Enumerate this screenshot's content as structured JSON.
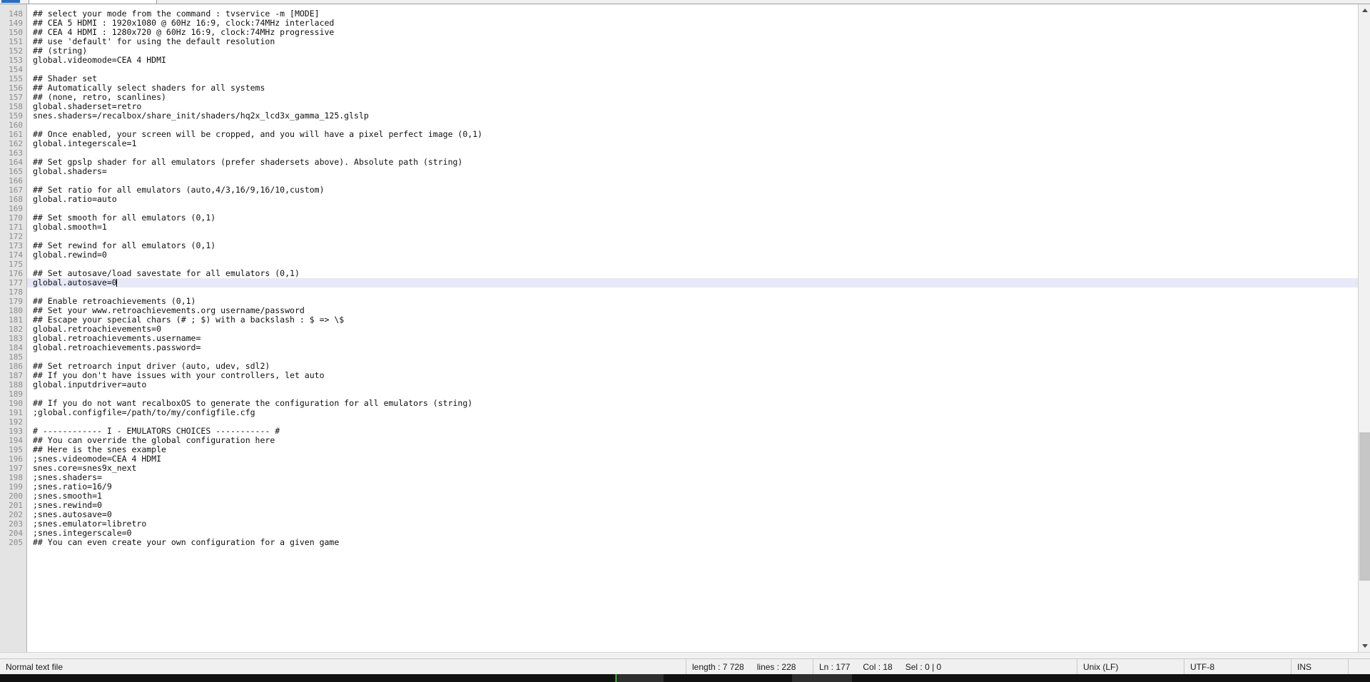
{
  "window": {
    "app": "text-editor",
    "colors": {
      "gutter_bg": "#e4e4e4",
      "gutter_fg": "#8c8c8c",
      "text_fg": "#101010",
      "current_line_bg": "#e8e8f8",
      "chrome_bg": "#f0f0f0"
    }
  },
  "editor": {
    "first_line": 148,
    "current_line": 177,
    "lines": [
      {
        "n": 148,
        "text": "## select your mode from the command : tvservice -m [MODE]"
      },
      {
        "n": 149,
        "text": "## CEA 5 HDMI : 1920x1080 @ 60Hz 16:9, clock:74MHz interlaced"
      },
      {
        "n": 150,
        "text": "## CEA 4 HDMI : 1280x720 @ 60Hz 16:9, clock:74MHz progressive"
      },
      {
        "n": 151,
        "text": "## use 'default' for using the default resolution"
      },
      {
        "n": 152,
        "text": "## (string)"
      },
      {
        "n": 153,
        "text": "global.videomode=CEA 4 HDMI"
      },
      {
        "n": 154,
        "text": ""
      },
      {
        "n": 155,
        "text": "## Shader set"
      },
      {
        "n": 156,
        "text": "## Automatically select shaders for all systems"
      },
      {
        "n": 157,
        "text": "## (none, retro, scanlines)"
      },
      {
        "n": 158,
        "text": "global.shaderset=retro"
      },
      {
        "n": 159,
        "text": "snes.shaders=/recalbox/share_init/shaders/hq2x_lcd3x_gamma_125.glslp"
      },
      {
        "n": 160,
        "text": ""
      },
      {
        "n": 161,
        "text": "## Once enabled, your screen will be cropped, and you will have a pixel perfect image (0,1)"
      },
      {
        "n": 162,
        "text": "global.integerscale=1"
      },
      {
        "n": 163,
        "text": ""
      },
      {
        "n": 164,
        "text": "## Set gpslp shader for all emulators (prefer shadersets above). Absolute path (string)"
      },
      {
        "n": 165,
        "text": "global.shaders="
      },
      {
        "n": 166,
        "text": ""
      },
      {
        "n": 167,
        "text": "## Set ratio for all emulators (auto,4/3,16/9,16/10,custom)"
      },
      {
        "n": 168,
        "text": "global.ratio=auto"
      },
      {
        "n": 169,
        "text": ""
      },
      {
        "n": 170,
        "text": "## Set smooth for all emulators (0,1)"
      },
      {
        "n": 171,
        "text": "global.smooth=1"
      },
      {
        "n": 172,
        "text": ""
      },
      {
        "n": 173,
        "text": "## Set rewind for all emulators (0,1)"
      },
      {
        "n": 174,
        "text": "global.rewind=0"
      },
      {
        "n": 175,
        "text": ""
      },
      {
        "n": 176,
        "text": "## Set autosave/load savestate for all emulators (0,1)"
      },
      {
        "n": 177,
        "text": "global.autosave=0"
      },
      {
        "n": 178,
        "text": ""
      },
      {
        "n": 179,
        "text": "## Enable retroachievements (0,1)"
      },
      {
        "n": 180,
        "text": "## Set your www.retroachievements.org username/password"
      },
      {
        "n": 181,
        "text": "## Escape your special chars (# ; $) with a backslash : $ => \\$"
      },
      {
        "n": 182,
        "text": "global.retroachievements=0"
      },
      {
        "n": 183,
        "text": "global.retroachievements.username="
      },
      {
        "n": 184,
        "text": "global.retroachievements.password="
      },
      {
        "n": 185,
        "text": ""
      },
      {
        "n": 186,
        "text": "## Set retroarch input driver (auto, udev, sdl2)"
      },
      {
        "n": 187,
        "text": "## If you don't have issues with your controllers, let auto"
      },
      {
        "n": 188,
        "text": "global.inputdriver=auto"
      },
      {
        "n": 189,
        "text": ""
      },
      {
        "n": 190,
        "text": "## If you do not want recalboxOS to generate the configuration for all emulators (string)"
      },
      {
        "n": 191,
        "text": ";global.configfile=/path/to/my/configfile.cfg"
      },
      {
        "n": 192,
        "text": ""
      },
      {
        "n": 193,
        "text": "# ------------ I - EMULATORS CHOICES ----------- #"
      },
      {
        "n": 194,
        "text": "## You can override the global configuration here"
      },
      {
        "n": 195,
        "text": "## Here is the snes example"
      },
      {
        "n": 196,
        "text": ";snes.videomode=CEA 4 HDMI"
      },
      {
        "n": 197,
        "text": "snes.core=snes9x_next"
      },
      {
        "n": 198,
        "text": ";snes.shaders="
      },
      {
        "n": 199,
        "text": ";snes.ratio=16/9"
      },
      {
        "n": 200,
        "text": ";snes.smooth=1"
      },
      {
        "n": 201,
        "text": ";snes.rewind=0"
      },
      {
        "n": 202,
        "text": ";snes.autosave=0"
      },
      {
        "n": 203,
        "text": ";snes.emulator=libretro"
      },
      {
        "n": 204,
        "text": ";snes.integerscale=0"
      },
      {
        "n": 205,
        "text": "## You can even create your own configuration for a given game"
      }
    ]
  },
  "scrollbar": {
    "up_arrow": "chevron-up-icon",
    "down_arrow": "chevron-down-icon"
  },
  "status": {
    "file_type": "Normal text file",
    "length_label": "length : 7 728",
    "lines_label": "lines : 228",
    "ln_label": "Ln : 177",
    "col_label": "Col : 18",
    "sel_label": "Sel : 0 | 0",
    "eol": "Unix (LF)",
    "encoding": "UTF-8",
    "insert_mode": "INS"
  }
}
